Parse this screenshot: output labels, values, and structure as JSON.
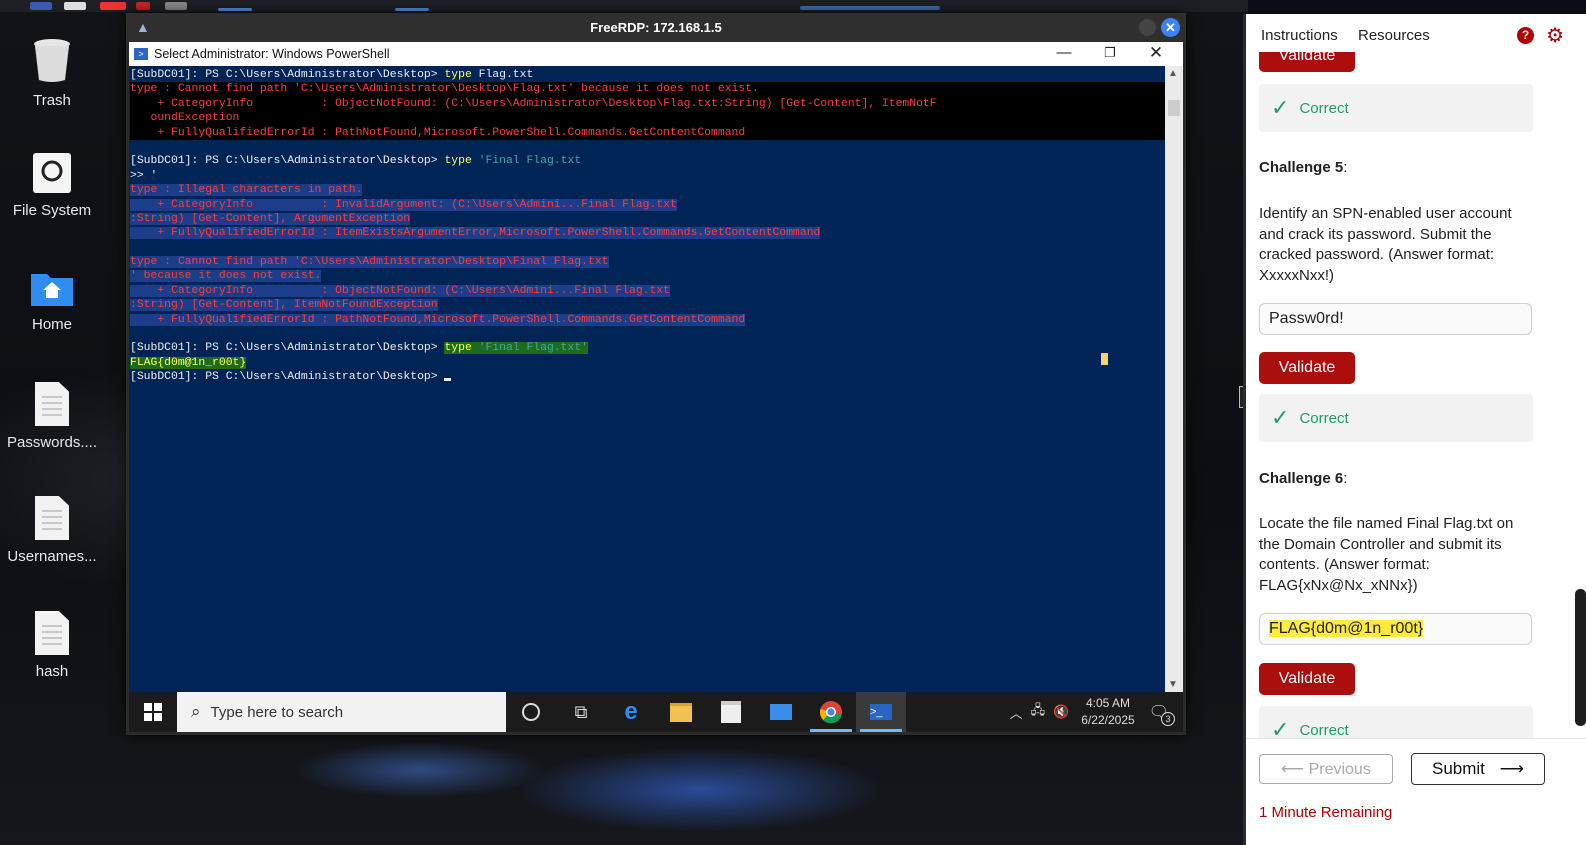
{
  "desktop": {
    "icons": [
      {
        "label": "Trash"
      },
      {
        "label": "File System"
      },
      {
        "label": "Home"
      },
      {
        "label": "Passwords...."
      },
      {
        "label": "Usernames..."
      },
      {
        "label": "hash"
      }
    ]
  },
  "rdp": {
    "title": "FreeRDP: 172.168.1.5"
  },
  "powershell": {
    "title": "Select Administrator: Windows PowerShell",
    "lines": {
      "l1_prompt": "[SubDC01]: PS C:\\Users\\Administrator\\Desktop> ",
      "l1_cmd": "type",
      "l1_arg": " Flag.txt",
      "l2": "type : Cannot find path 'C:\\Users\\Administrator\\Desktop\\Flag.txt' because it does not exist.",
      "l3": "    + CategoryInfo          : ObjectNotFound: (C:\\Users\\Administrator\\Desktop\\Flag.txt:String) [Get-Content], ItemNotF",
      "l4": "   oundException",
      "l5": "    + FullyQualifiedErrorId : PathNotFound,Microsoft.PowerShell.Commands.GetContentCommand",
      "l7_prompt": "[SubDC01]: PS C:\\Users\\Administrator\\Desktop> ",
      "l7_cmd": "type",
      "l7_arg": " 'Final Flag.txt",
      "l8": ">> '",
      "l9": "type : Illegal characters in path.",
      "l10": "    + CategoryInfo          : InvalidArgument: (C:\\Users\\Admini...Final Flag.txt",
      "l11": ":String) [Get-Content], ArgumentException",
      "l12": "    + FullyQualifiedErrorId : ItemExistsArgumentError,Microsoft.PowerShell.Commands.GetContentCommand",
      "l14": "type : Cannot find path 'C:\\Users\\Administrator\\Desktop\\Final Flag.txt",
      "l15": "' because it does not exist.",
      "l16": "    + CategoryInfo          : ObjectNotFound: (C:\\Users\\Admini...Final Flag.txt",
      "l17": ":String) [Get-Content], ItemNotFoundException",
      "l18": "    + FullyQualifiedErrorId : PathNotFound,Microsoft.PowerShell.Commands.GetContentCommand",
      "l20_prompt": "[SubDC01]: PS C:\\Users\\Administrator\\Desktop> ",
      "l20_cmd": "type",
      "l20_arg": " 'Final Flag.txt'",
      "l21": "FLAG{d0m@1n_r00t}",
      "l22_prompt": "[SubDC01]: PS C:\\Users\\Administrator\\Desktop> "
    }
  },
  "taskbar": {
    "search_placeholder": "Type here to search",
    "time": "4:05 AM",
    "date": "6/22/2025",
    "notification_count": "3"
  },
  "panel": {
    "tabs": [
      "Instructions",
      "Resources"
    ],
    "validate_label": "Validate",
    "correct_label": "Correct",
    "challenge5": {
      "title": "Challenge 5",
      "text": "Identify an SPN-enabled user account and crack its password. Submit the cracked password. (Answer format: XxxxxNxx!)",
      "answer": "Passw0rd!"
    },
    "challenge6": {
      "title": "Challenge 6",
      "text": "Locate the file named Final Flag.txt on the Domain Controller and submit its contents. (Answer format: FLAG{xNx@Nx_xNNx})",
      "answer": "FLAG{d0m@1n_r00t}"
    },
    "previous_label": "Previous",
    "submit_label": "Submit",
    "remaining": "1 Minute Remaining"
  },
  "colors": {
    "console_bg": "#012456",
    "validate_red": "#ac0d0d",
    "correct_green": "#1f9e62",
    "highlight_yellow": "#ffeb3b"
  }
}
